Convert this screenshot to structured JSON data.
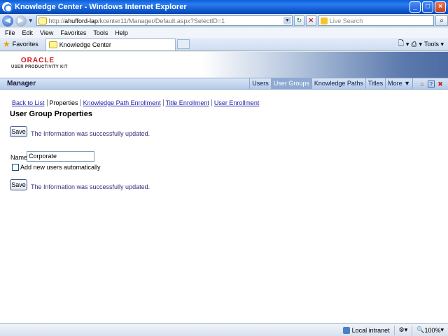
{
  "window": {
    "title": "Knowledge Center - Windows Internet Explorer",
    "minimize": "_",
    "maximize": "□",
    "close": "×"
  },
  "address": {
    "prefix": "http://",
    "host": "ahufford-lap",
    "path": "/kcenter11/Manager/Default.aspx?SelectID=1",
    "search_placeholder": "Live Search"
  },
  "menu": [
    "File",
    "Edit",
    "View",
    "Favorites",
    "Tools",
    "Help"
  ],
  "favorites": {
    "label": "Favorites",
    "tab_title": "Knowledge Center",
    "page_menu": "▾",
    "tools": "Tools ▾"
  },
  "logo": {
    "brand": "ORACLE",
    "product": "USER PRODUCTIVITY KIT"
  },
  "nav": {
    "title": "Manager",
    "links": [
      {
        "label": "Users",
        "active": false
      },
      {
        "label": "User Groups",
        "active": true
      },
      {
        "label": "Knowledge Paths",
        "active": false
      },
      {
        "label": "Titles",
        "active": false
      },
      {
        "label": "More ▼",
        "active": false
      }
    ]
  },
  "subtabs": [
    "Back to List",
    "Properties",
    "Knowledge Path Enrollment",
    "Title Enrollment",
    "User Enrollment"
  ],
  "page": {
    "title": "User Group Properties",
    "save_label": "Save",
    "message": "The Information was successfully updated.",
    "name_label": "Name",
    "name_value": "Corporate",
    "checkbox_label": "Add new users automatically",
    "checkbox_checked": false
  },
  "status": {
    "zone": "Local intranet",
    "zoom": "100%"
  }
}
